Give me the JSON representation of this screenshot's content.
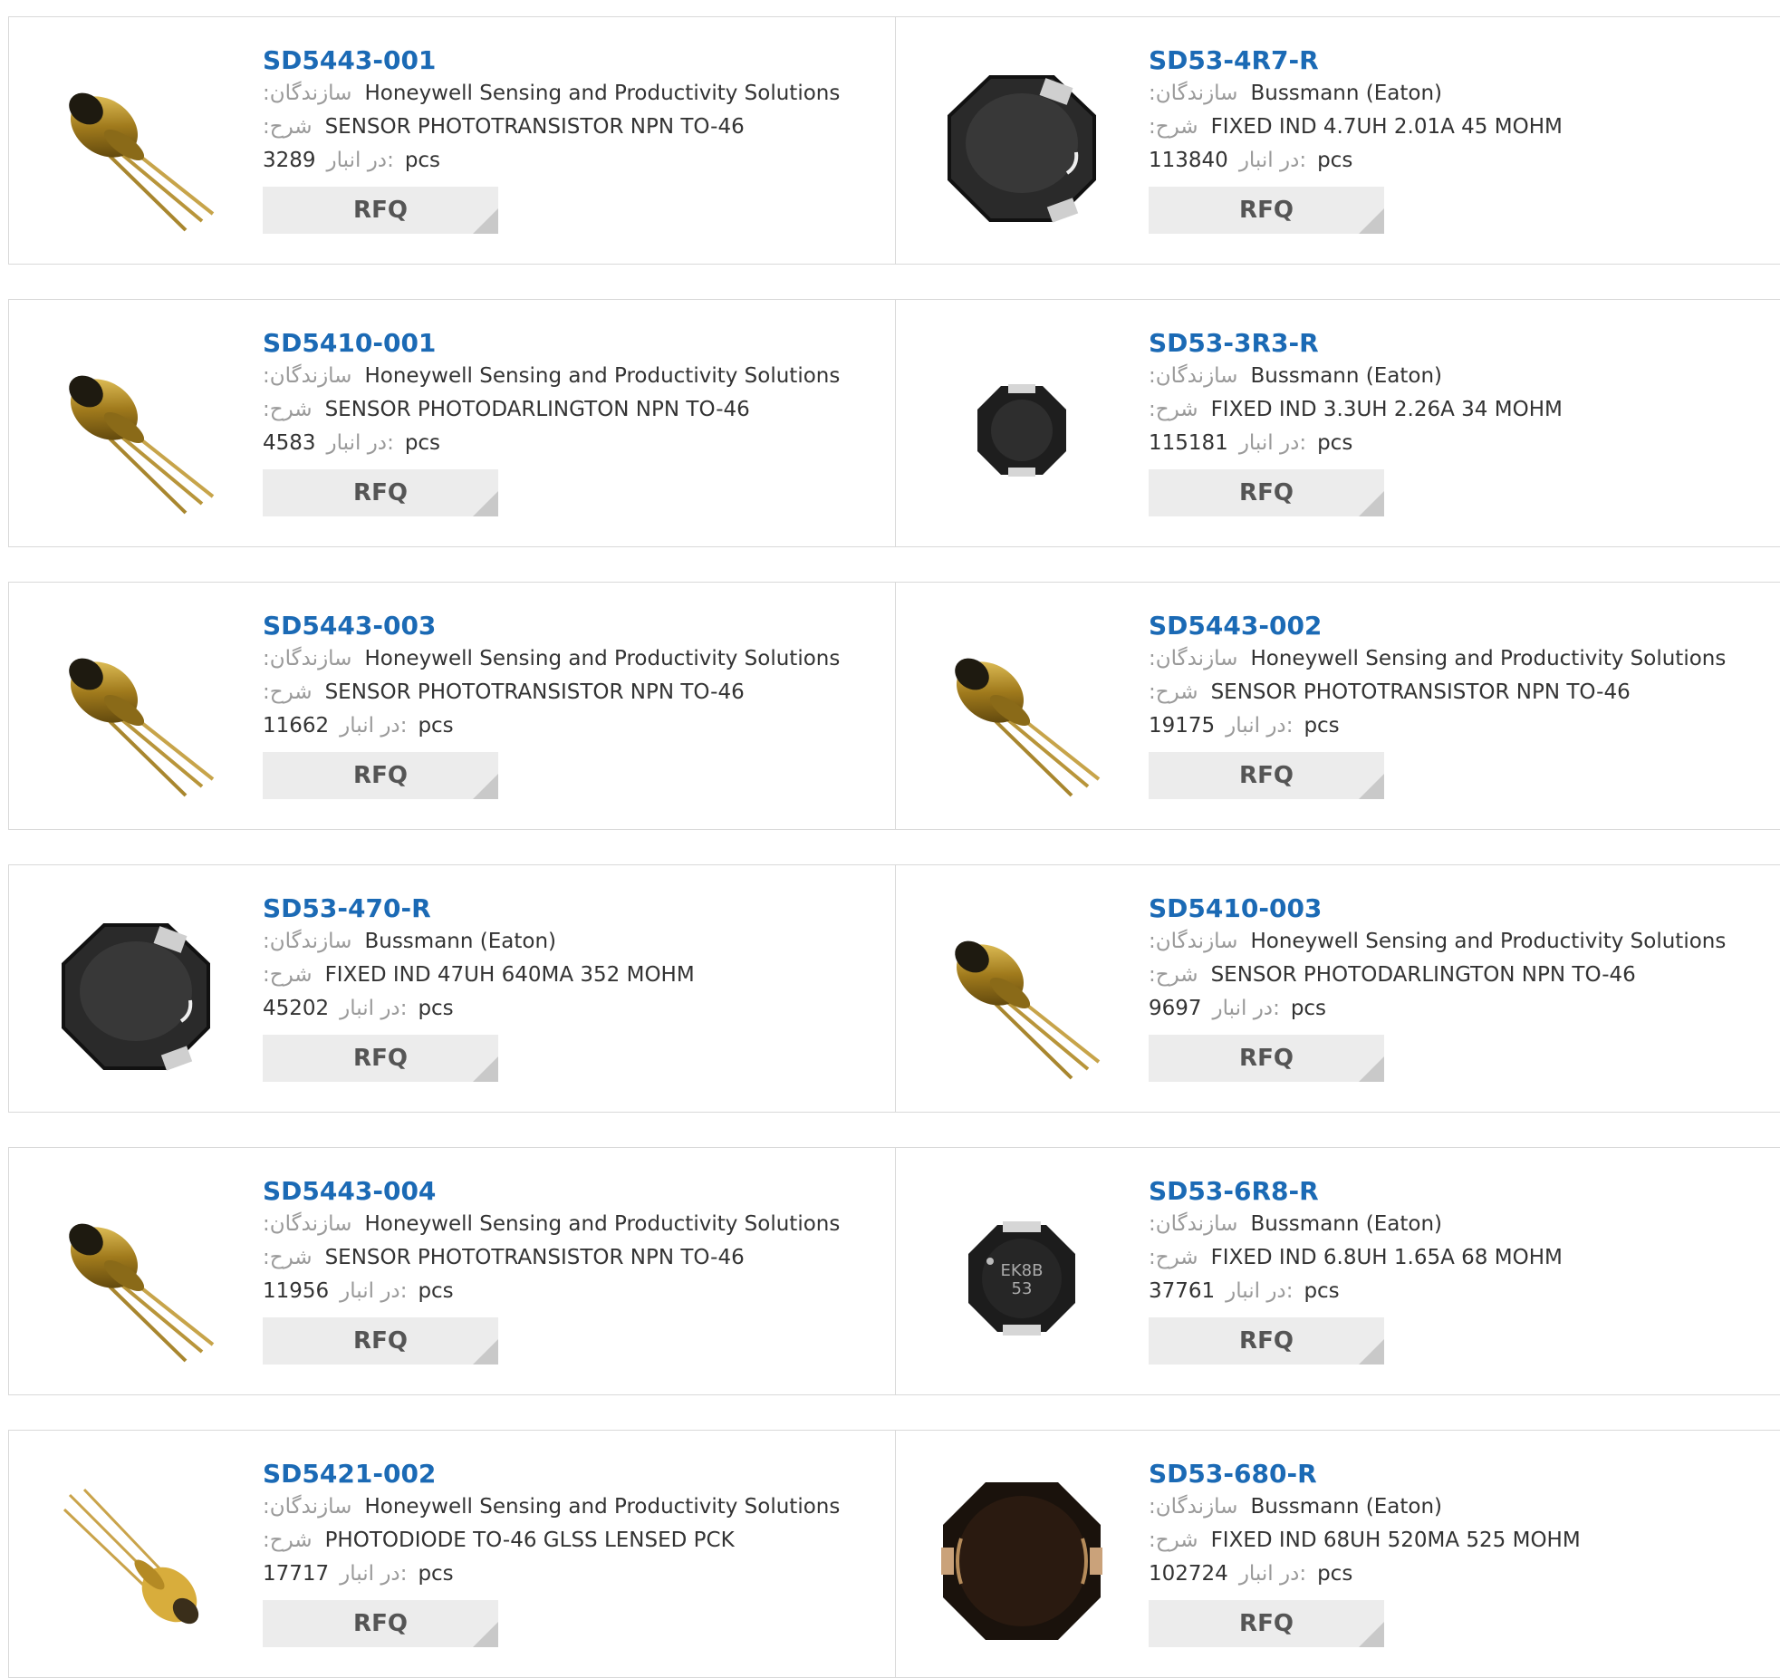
{
  "labels": {
    "manufacturer": ":سازندگان",
    "description": ":شرح",
    "in_stock": "در انبار:",
    "unit": "pcs",
    "rfq": "RFQ"
  },
  "products": [
    {
      "part": "SD5443-001",
      "manufacturer": "Honeywell Sensing and Productivity Solutions",
      "description": "SENSOR PHOTOTRANSISTOR NPN TO-46",
      "stock": "3289",
      "image": "to46-transistor-icon"
    },
    {
      "part": "SD53-4R7-R",
      "manufacturer": "Bussmann (Eaton)",
      "description": "FIXED IND 4.7UH 2.01A 45 MOHM",
      "stock": "113840",
      "image": "inductor-large-icon"
    },
    {
      "part": "SD5410-001",
      "manufacturer": "Honeywell Sensing and Productivity Solutions",
      "description": "SENSOR PHOTODARLINGTON NPN TO-46",
      "stock": "4583",
      "image": "to46-transistor-icon"
    },
    {
      "part": "SD53-3R3-R",
      "manufacturer": "Bussmann (Eaton)",
      "description": "FIXED IND 3.3UH 2.26A 34 MOHM",
      "stock": "115181",
      "image": "inductor-small-icon"
    },
    {
      "part": "SD5443-003",
      "manufacturer": "Honeywell Sensing and Productivity Solutions",
      "description": "SENSOR PHOTOTRANSISTOR NPN TO-46",
      "stock": "11662",
      "image": "to46-transistor-icon"
    },
    {
      "part": "SD5443-002",
      "manufacturer": "Honeywell Sensing and Productivity Solutions",
      "description": "SENSOR PHOTOTRANSISTOR NPN TO-46",
      "stock": "19175",
      "image": "to46-transistor-icon"
    },
    {
      "part": "SD53-470-R",
      "manufacturer": "Bussmann (Eaton)",
      "description": "FIXED IND 47UH 640MA 352 MOHM",
      "stock": "45202",
      "image": "inductor-large-icon"
    },
    {
      "part": "SD5410-003",
      "manufacturer": "Honeywell Sensing and Productivity Solutions",
      "description": "SENSOR PHOTODARLINGTON NPN TO-46",
      "stock": "9697",
      "image": "to46-transistor-icon"
    },
    {
      "part": "SD5443-004",
      "manufacturer": "Honeywell Sensing and Productivity Solutions",
      "description": "SENSOR PHOTOTRANSISTOR NPN TO-46",
      "stock": "11956",
      "image": "to46-transistor-icon"
    },
    {
      "part": "SD53-6R8-R",
      "manufacturer": "Bussmann (Eaton)",
      "description": "FIXED IND 6.8UH 1.65A 68 MOHM",
      "stock": "37761",
      "image": "inductor-marked-icon",
      "marking": "EK8B 53"
    },
    {
      "part": "SD5421-002",
      "manufacturer": "Honeywell Sensing and Productivity Solutions",
      "description": "PHOTODIODE TO-46 GLSS LENSED PCK",
      "stock": "17717",
      "image": "photodiode-icon"
    },
    {
      "part": "SD53-680-R",
      "manufacturer": "Bussmann (Eaton)",
      "description": "FIXED IND 68UH 520MA 525 MOHM",
      "stock": "102724",
      "image": "inductor-dark-icon"
    }
  ],
  "colors": {
    "part_link": "#1b6ab5",
    "label_gray": "#9a9a9a",
    "border": "#d9d9d9",
    "rfq_bg": "#ececec"
  }
}
